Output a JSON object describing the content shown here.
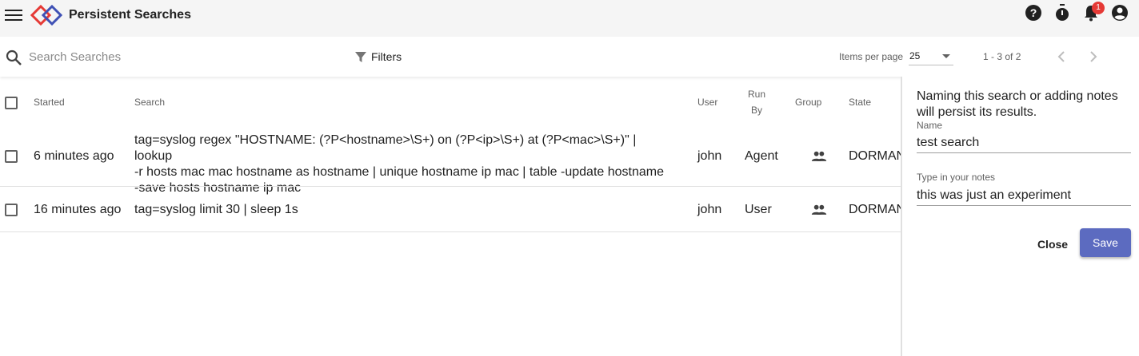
{
  "app": {
    "title": "Persistent Searches",
    "notification_count": "1"
  },
  "icons": {
    "menu": "menu-icon",
    "logo": "app-logo",
    "help": "help-icon",
    "timer": "timer-icon",
    "notifications": "bell-icon",
    "account": "account-icon",
    "search": "search-icon",
    "filter": "filter-icon",
    "group": "group-icon"
  },
  "toolbar": {
    "search_placeholder": "Search Searches",
    "filters_label": "Filters",
    "items_per_page_label": "Items per page",
    "items_per_page_value": "25",
    "range_label": "1 - 3 of 2"
  },
  "table": {
    "headers": {
      "started": "Started",
      "search": "Search",
      "user": "User",
      "run_by_1": "Run",
      "run_by_2": "By",
      "group": "Group",
      "state": "State"
    },
    "rows": [
      {
        "started": "6 minutes ago",
        "search_lines": [
          "tag=syslog regex \"HOSTNAME: (?P<hostname>\\S+) on (?P<ip>\\S+) at (?P<mac>\\S+)\" | lookup",
          "-r hosts mac mac hostname as hostname | unique hostname ip mac | table -update hostname",
          "-save hosts hostname ip mac"
        ],
        "user": "john",
        "run_by": "Agent",
        "state": "DORMAN"
      },
      {
        "started": "16 minutes ago",
        "search_lines": [
          "tag=syslog limit 30 | sleep 1s"
        ],
        "user": "john",
        "run_by": "User",
        "state": "DORMAN"
      }
    ]
  },
  "panel": {
    "message": "Naming this search or adding notes will persist its results.",
    "name_label": "Name",
    "name_value": "test search",
    "notes_label": "Type in your notes",
    "notes_value": "this was just an experiment",
    "close_label": "Close",
    "save_label": "Save"
  },
  "colors": {
    "accent": "#5c6bc0",
    "badge": "#e53935",
    "topbar": "#f5f5f5",
    "logo_red": "#e53935",
    "logo_blue": "#3f51b5"
  }
}
